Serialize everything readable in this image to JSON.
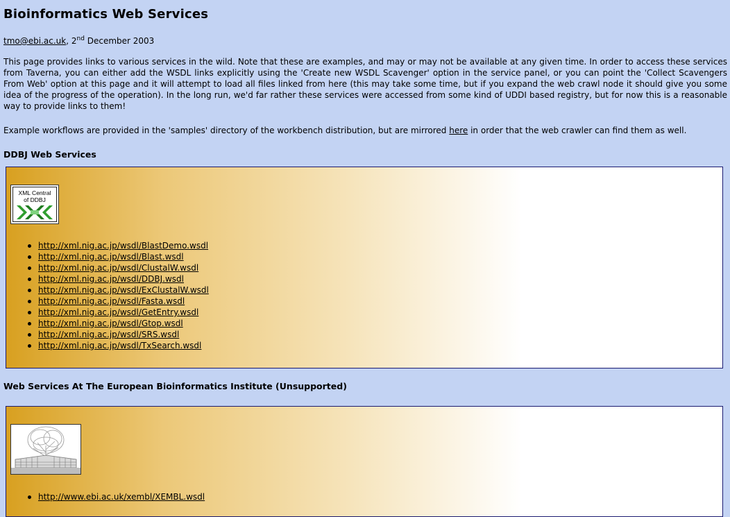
{
  "title": "Bioinformatics Web Services",
  "byline": {
    "email": "tmo@ebi.ac.uk",
    "date_prefix": ", 2",
    "date_sup": "nd",
    "date_suffix": " December 2003"
  },
  "intro": "This page provides links to various services in the wild. Note that these are examples, and may or may not be available at any given time. In order to access these services from Taverna, you can either add the WSDL links explicitly using the 'Create new WSDL Scavenger' option in the service panel, or you can point the 'Collect Scavengers From Web' option at this page and it will attempt to load all files linked from here (this may take some time, but if you expand the web crawl node it should give you some idea of the progress of the operation). In the long run, we'd far rather these services were accessed from some kind of UDDI based registry, but for now this is a reasonable way to provide links to them!",
  "example": {
    "before": "Example workflows are provided in the 'samples' directory of the workbench distribution, but are mirrored ",
    "link": "here",
    "after": " in order that the web crawler can find them as well."
  },
  "sections": {
    "ddbj": {
      "heading": "DDBJ Web Services",
      "logo_line1": "XML Central",
      "logo_line2": "of DDBJ",
      "links": [
        "http://xml.nig.ac.jp/wsdl/BlastDemo.wsdl",
        "http://xml.nig.ac.jp/wsdl/Blast.wsdl",
        "http://xml.nig.ac.jp/wsdl/ClustalW.wsdl",
        "http://xml.nig.ac.jp/wsdl/DDBJ.wsdl",
        "http://xml.nig.ac.jp/wsdl/ExClustalW.wsdl",
        "http://xml.nig.ac.jp/wsdl/Fasta.wsdl",
        "http://xml.nig.ac.jp/wsdl/GetEntry.wsdl",
        "http://xml.nig.ac.jp/wsdl/Gtop.wsdl",
        "http://xml.nig.ac.jp/wsdl/SRS.wsdl",
        "http://xml.nig.ac.jp/wsdl/TxSearch.wsdl"
      ]
    },
    "ebi": {
      "heading": "Web Services At The European Bioinformatics Institute (Unsupported)",
      "links": [
        "http://www.ebi.ac.uk/xembl/XEMBL.wsdl"
      ]
    }
  },
  "colors": {
    "background": "#c3d3f3",
    "panel_gold": "#d8a020",
    "panel_border": "#1a1a70"
  }
}
